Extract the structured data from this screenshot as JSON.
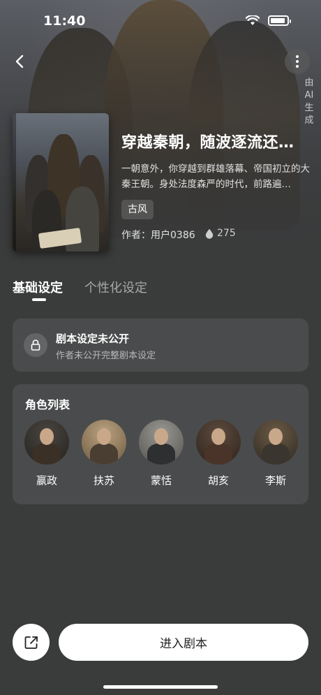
{
  "status_bar": {
    "time": "11:40"
  },
  "story": {
    "title": "穿越秦朝，随波逐流还…",
    "description": "一朝意外，你穿越到群雄落幕、帝国初立的大秦王朝。身处法度森严的时代，前路遍…",
    "genre": "古风",
    "author": "作者：用户0386",
    "heat": "275",
    "ai_label": "由AI生成"
  },
  "tabs": [
    {
      "label": "基础设定",
      "active": true
    },
    {
      "label": "个性化设定",
      "active": false
    }
  ],
  "locked_card": {
    "title": "剧本设定未公开",
    "subtitle": "作者未公开完整剧本设定"
  },
  "characters": {
    "title": "角色列表",
    "items": [
      {
        "name": "嬴政",
        "color": "#3b3026"
      },
      {
        "name": "扶苏",
        "color": "#5a4a3a"
      },
      {
        "name": "蒙恬",
        "color": "#3c3d3e"
      },
      {
        "name": "胡亥",
        "color": "#4a3328"
      },
      {
        "name": "李斯",
        "color": "#3a352e"
      }
    ]
  },
  "actions": {
    "enter_label": "进入剧本"
  },
  "colors": {
    "background": "#3a3b3b",
    "card": "#4a4b4c",
    "button": "#ffffff"
  }
}
